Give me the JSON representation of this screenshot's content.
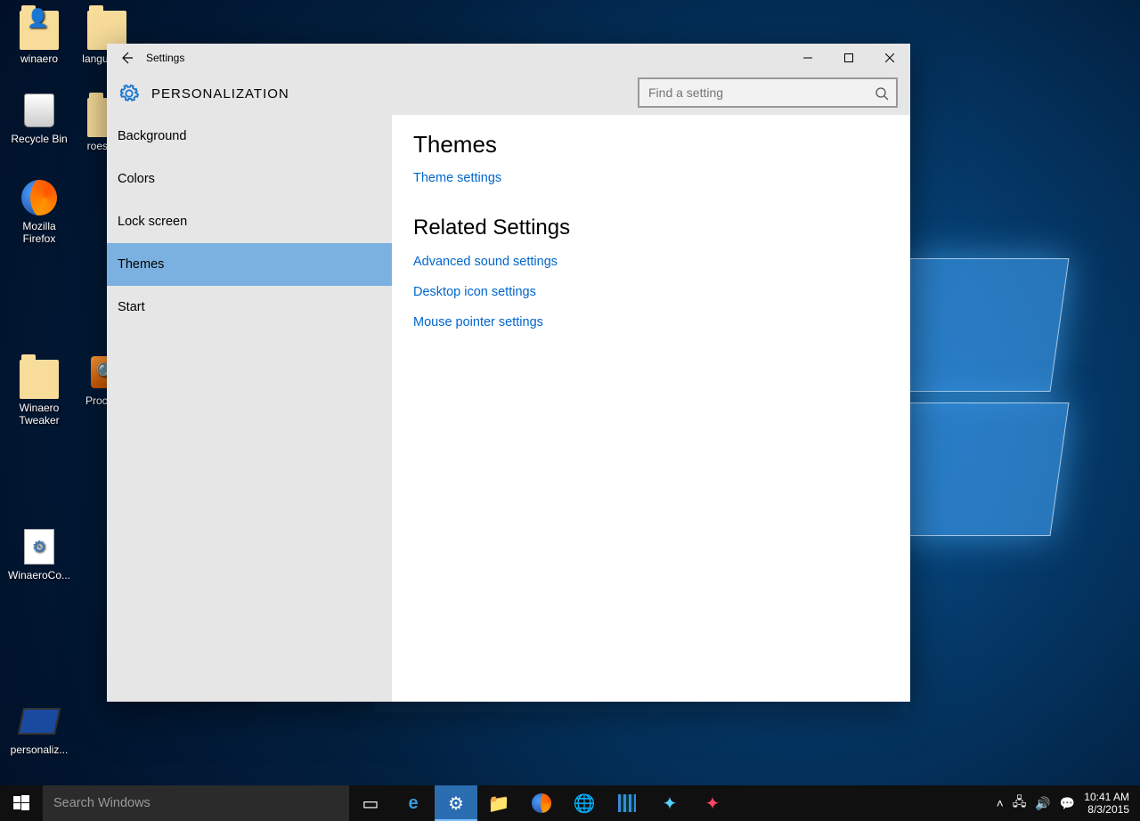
{
  "desktop": {
    "icons": [
      {
        "label": "winaero"
      },
      {
        "label": "languages"
      },
      {
        "label": "Recycle Bin"
      },
      {
        "label": "roesozlc"
      },
      {
        "label": "Mozilla Firefox"
      },
      {
        "label": "Winaero Tweaker"
      },
      {
        "label": "Procmon"
      },
      {
        "label": "WinaeroCo..."
      },
      {
        "label": "personaliz..."
      }
    ]
  },
  "window": {
    "title": "Settings",
    "section": "PERSONALIZATION",
    "search_placeholder": "Find a setting",
    "sidebar": [
      {
        "label": "Background",
        "selected": false
      },
      {
        "label": "Colors",
        "selected": false
      },
      {
        "label": "Lock screen",
        "selected": false
      },
      {
        "label": "Themes",
        "selected": true
      },
      {
        "label": "Start",
        "selected": false
      }
    ],
    "content": {
      "heading1": "Themes",
      "link1": "Theme settings",
      "heading2": "Related Settings",
      "links2": [
        "Advanced sound settings",
        "Desktop icon settings",
        "Mouse pointer settings"
      ]
    }
  },
  "taskbar": {
    "search_placeholder": "Search Windows",
    "time": "10:41 AM",
    "date": "8/3/2015"
  }
}
